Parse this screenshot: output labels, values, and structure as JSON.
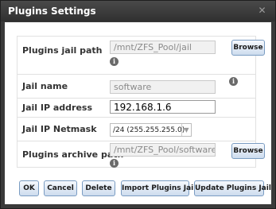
{
  "dialog": {
    "title": "Plugins Settings",
    "close_icon": "close-icon"
  },
  "form": {
    "plugins_jail_path": {
      "label": "Plugins jail path",
      "value": "/mnt/ZFS_Pool/jail",
      "browse": "Browse"
    },
    "jail_name": {
      "label": "Jail name",
      "value": "software"
    },
    "jail_ip_address": {
      "label": "Jail IP address",
      "value": "192.168.1.6"
    },
    "jail_ip_netmask": {
      "label": "Jail IP Netmask",
      "value": "/24 (255.255.255.0)"
    },
    "plugins_archive_path": {
      "label": "Plugins archive path",
      "value": "/mnt/ZFS_Pool/software",
      "browse": "Browse"
    },
    "info_glyph": "i"
  },
  "buttons": {
    "ok": "OK",
    "cancel": "Cancel",
    "delete": "Delete",
    "import": "Import Plugins Jail",
    "update": "Update Plugins Jail"
  }
}
